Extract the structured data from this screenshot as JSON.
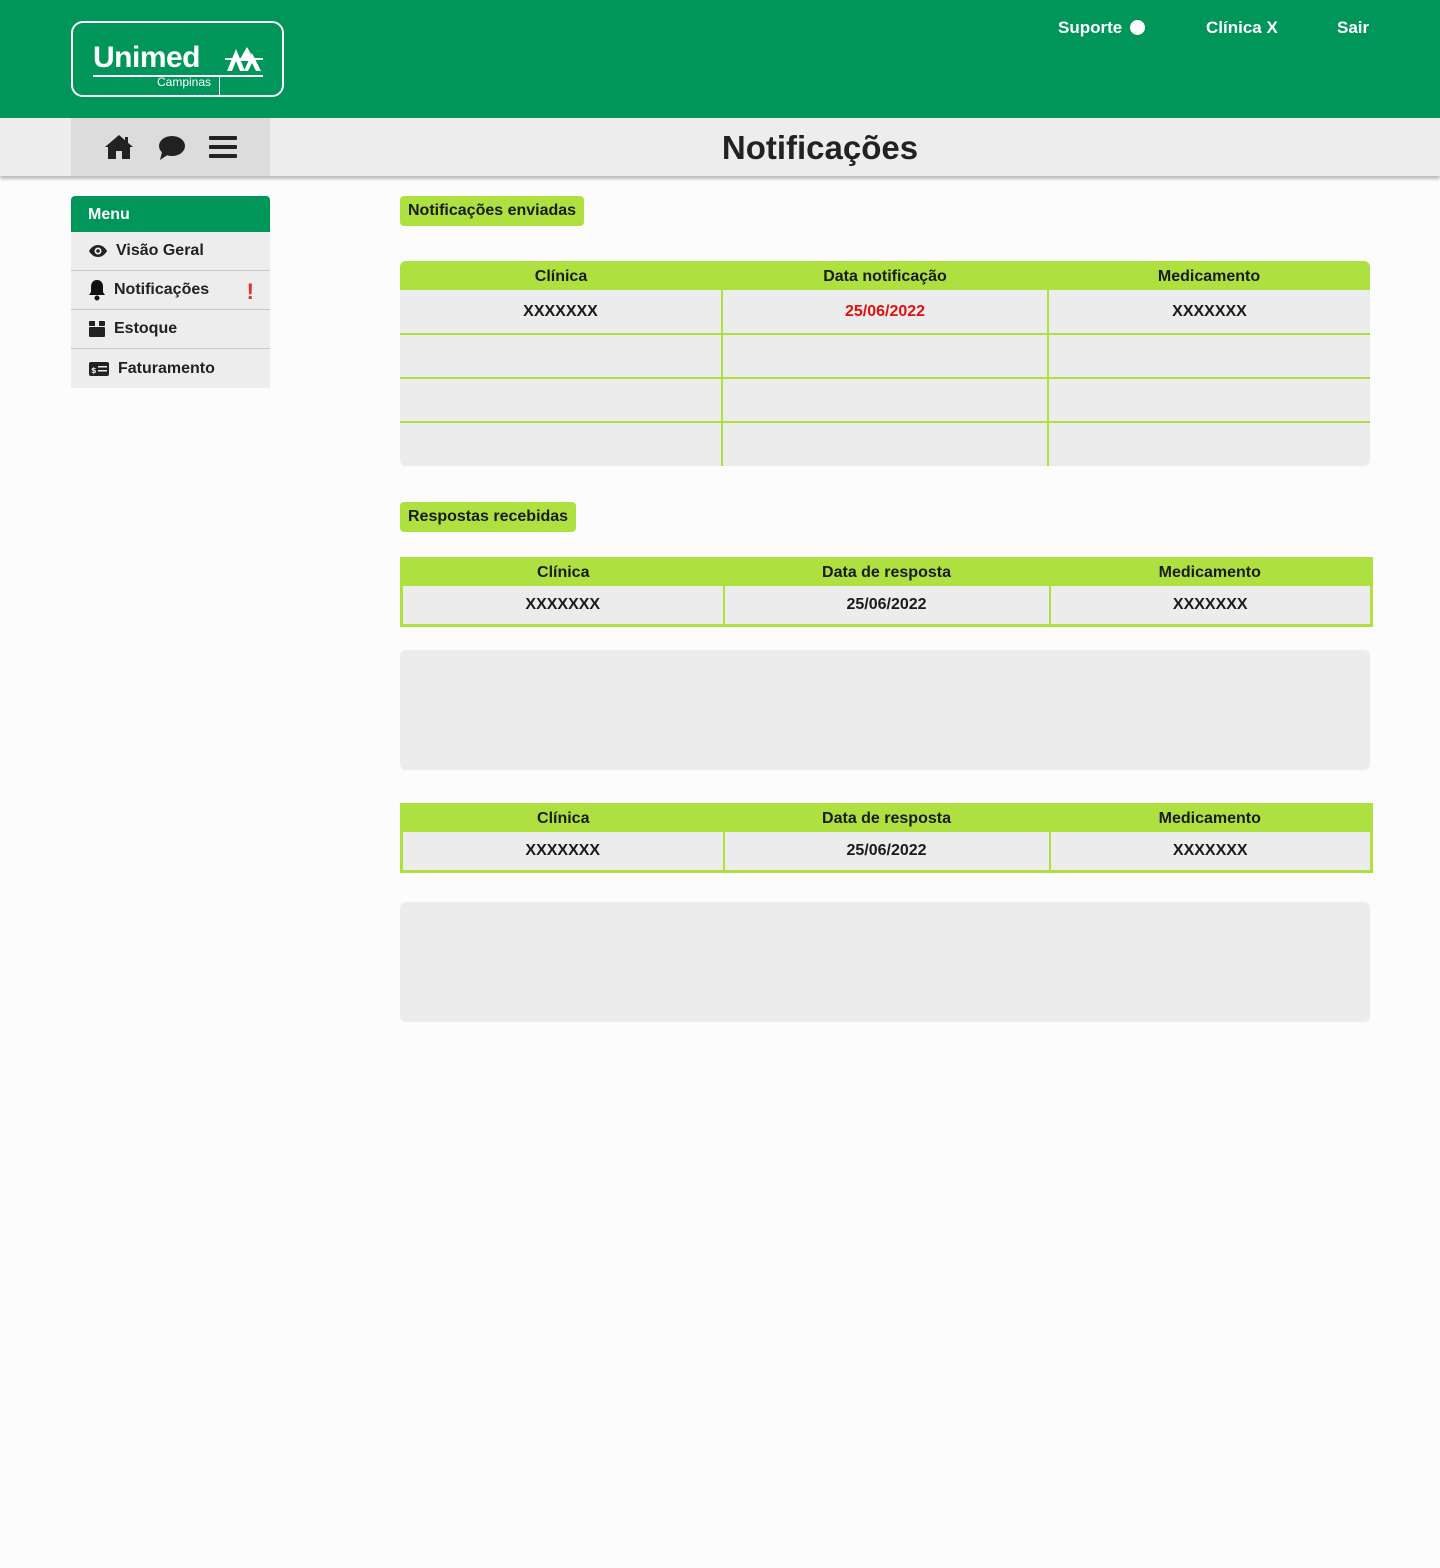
{
  "brand": {
    "logo_text": "Unimed",
    "logo_subtext": "Campinas",
    "colors": {
      "primary": "#00965a",
      "accent": "#aee03f",
      "alert": "#e03030"
    }
  },
  "header": {
    "support_label": "Suporte",
    "clinic_label": "Clínica X",
    "logout_label": "Sair"
  },
  "toolbar": {
    "icons": [
      "home-icon",
      "chat-icon",
      "hamburger-menu-icon"
    ]
  },
  "page": {
    "title": "Notificações"
  },
  "sidebar": {
    "heading": "Menu",
    "items": [
      {
        "label": "Visão Geral",
        "icon": "eye-icon"
      },
      {
        "label": "Notificações",
        "icon": "bell-icon",
        "alert": "!"
      },
      {
        "label": "Estoque",
        "icon": "box-icon"
      },
      {
        "label": "Faturamento",
        "icon": "billing-icon"
      }
    ]
  },
  "sent": {
    "label": "Notificações enviadas",
    "columns": [
      "Clínica",
      "Data notificação",
      "Medicamento"
    ],
    "rows": [
      [
        "XXXXXXX",
        "25/06/2022",
        "XXXXXXX"
      ],
      [
        "",
        "",
        ""
      ],
      [
        "",
        "",
        ""
      ],
      [
        "",
        "",
        ""
      ]
    ]
  },
  "received": {
    "label": "Respostas recebidas",
    "tables": [
      {
        "columns": [
          "Clínica",
          "Data de resposta",
          "Medicamento"
        ],
        "row": [
          "XXXXXXX",
          "25/06/2022",
          "XXXXXXX"
        ]
      },
      {
        "columns": [
          "Clínica",
          "Data de resposta",
          "Medicamento"
        ],
        "row": [
          "XXXXXXX",
          "25/06/2022",
          "XXXXXXX"
        ]
      }
    ]
  }
}
